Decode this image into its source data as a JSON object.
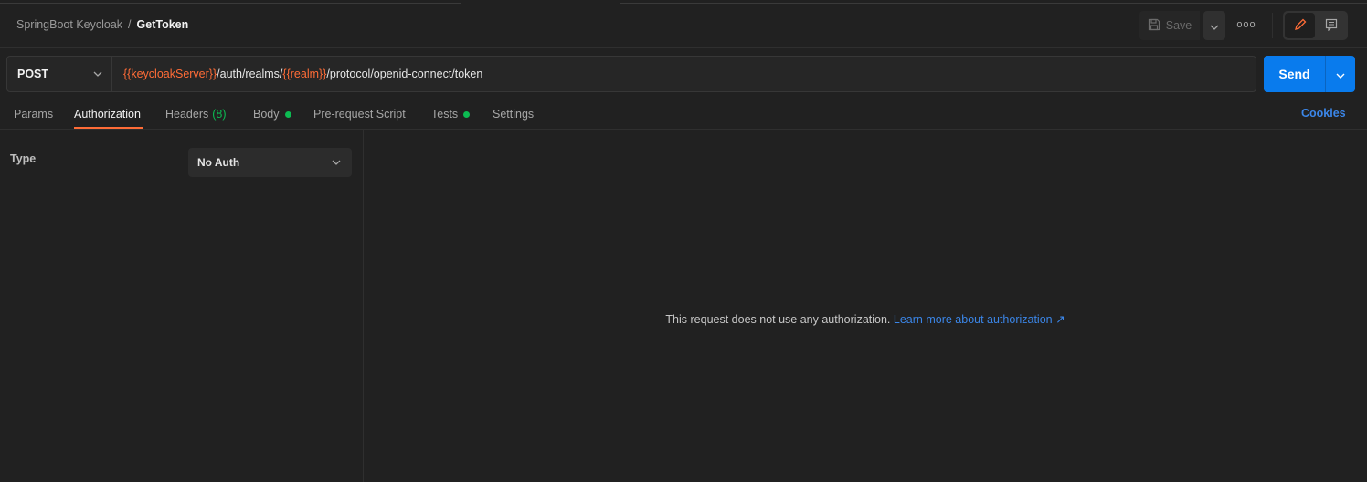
{
  "breadcrumb": {
    "parent": "SpringBoot Keycloak",
    "separator": "/",
    "current": "GetToken"
  },
  "header": {
    "save_label": "Save",
    "more_label": "ooo"
  },
  "request": {
    "method": "POST",
    "url_parts": [
      {
        "text": "{{keycloakServer}}",
        "kind": "variable"
      },
      {
        "text": "/auth/realms/",
        "kind": "text"
      },
      {
        "text": "{{realm}}",
        "kind": "variable"
      },
      {
        "text": "/protocol/openid-connect/token",
        "kind": "text"
      }
    ],
    "send_label": "Send"
  },
  "tabs": {
    "params": "Params",
    "authorization": "Authorization",
    "headers": "Headers",
    "headers_count": "(8)",
    "body": "Body",
    "prerequest": "Pre-request Script",
    "tests": "Tests",
    "settings": "Settings",
    "cookies": "Cookies"
  },
  "auth": {
    "type_label": "Type",
    "selected": "No Auth"
  },
  "message": {
    "text": "This request does not use any authorization.",
    "link": "Learn more about authorization ↗"
  },
  "colors": {
    "accent": "#ff6c37",
    "primary": "#097bed",
    "link": "#3b86e8",
    "success": "#0cbb52",
    "background": "#212121"
  },
  "icons": {
    "save": "save-icon",
    "caret": "chevron-down-icon",
    "more": "more-icon",
    "edit": "pencil-icon",
    "docs": "comment-icon"
  }
}
